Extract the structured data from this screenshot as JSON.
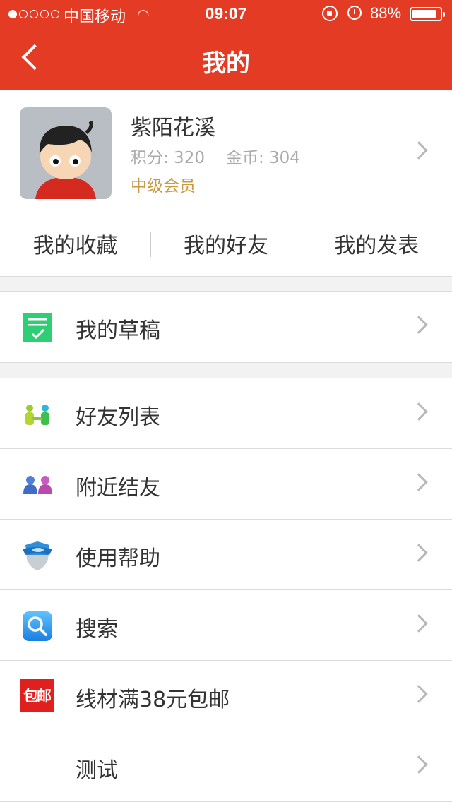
{
  "status_bar": {
    "carrier": "中国移动",
    "time": "09:07",
    "battery_percent_text": "88%",
    "battery_level": 0.88
  },
  "nav": {
    "title": "我的"
  },
  "profile": {
    "username": "紫陌花溪",
    "points_label": "积分: 320",
    "coins_label": "金币: 304",
    "level": "中级会员"
  },
  "quick_tabs": [
    {
      "label": "我的收藏"
    },
    {
      "label": "我的好友"
    },
    {
      "label": "我的发表"
    }
  ],
  "menu": {
    "drafts": {
      "label": "我的草稿",
      "icon": "drafts-icon"
    },
    "friends_list": {
      "label": "好友列表",
      "icon": "friends-icon"
    },
    "nearby": {
      "label": "附近结友",
      "icon": "nearby-people-icon"
    },
    "help": {
      "label": "使用帮助",
      "icon": "help-shield-icon"
    },
    "search": {
      "label": "搜索",
      "icon": "search-icon"
    },
    "free_shipping": {
      "label": "线材满38元包邮",
      "icon": "free-shipping-icon",
      "icon_text": "包邮"
    },
    "test": {
      "label": "测试"
    }
  },
  "colors": {
    "brand": "#e43b25",
    "level": "#c99a42",
    "drafts_icon": "#2ecf74"
  }
}
